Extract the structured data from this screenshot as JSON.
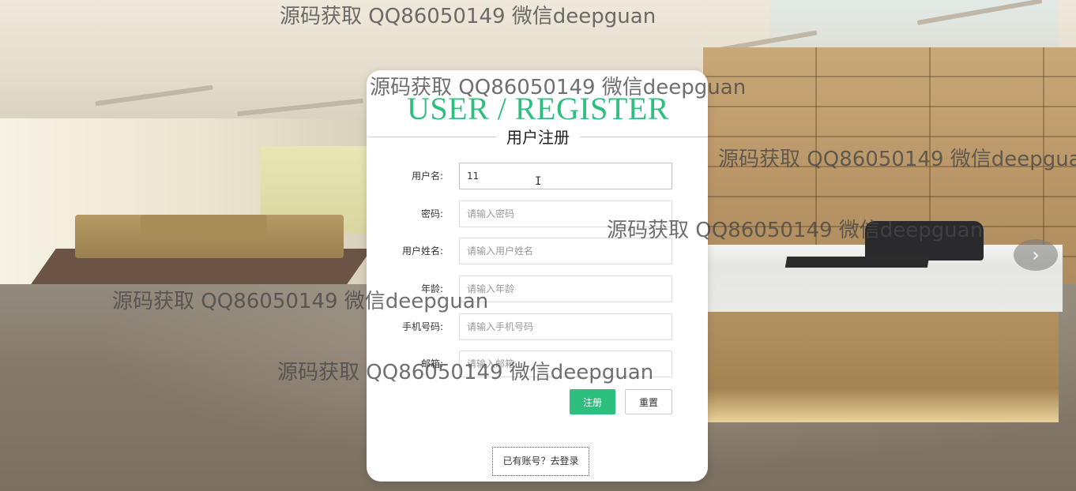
{
  "background": {
    "carousel_next_icon": "chevron-right-icon",
    "carousel_next_glyph": "›"
  },
  "card": {
    "title_en": "USER / REGISTER",
    "title_cn": "用户注册",
    "fields": [
      {
        "label": "用户名:",
        "value": "11",
        "placeholder": ""
      },
      {
        "label": "密码:",
        "value": "",
        "placeholder": "请输入密码"
      },
      {
        "label": "用户姓名:",
        "value": "",
        "placeholder": "请输入用户姓名"
      },
      {
        "label": "年龄:",
        "value": "",
        "placeholder": "请输入年龄"
      },
      {
        "label": "手机号码:",
        "value": "",
        "placeholder": "请输入手机号码"
      },
      {
        "label": "邮箱:",
        "value": "",
        "placeholder": "请输入邮箱"
      }
    ],
    "register_label": "注册",
    "reset_label": "重置",
    "login_link_label": "已有账号？去登录",
    "accent_color": "#2dbf7e"
  },
  "watermarks": [
    "源码获取 QQ86050149 微信deepguan",
    "源码获取 QQ86050149 微信deepguan",
    "源码获取 QQ86050149 微信deepguan",
    "源码获取 QQ86050149 微信deepguan",
    "源码获取 QQ86050149 微信deepguan",
    "源码获取 QQ86050149 微信deepguan"
  ]
}
